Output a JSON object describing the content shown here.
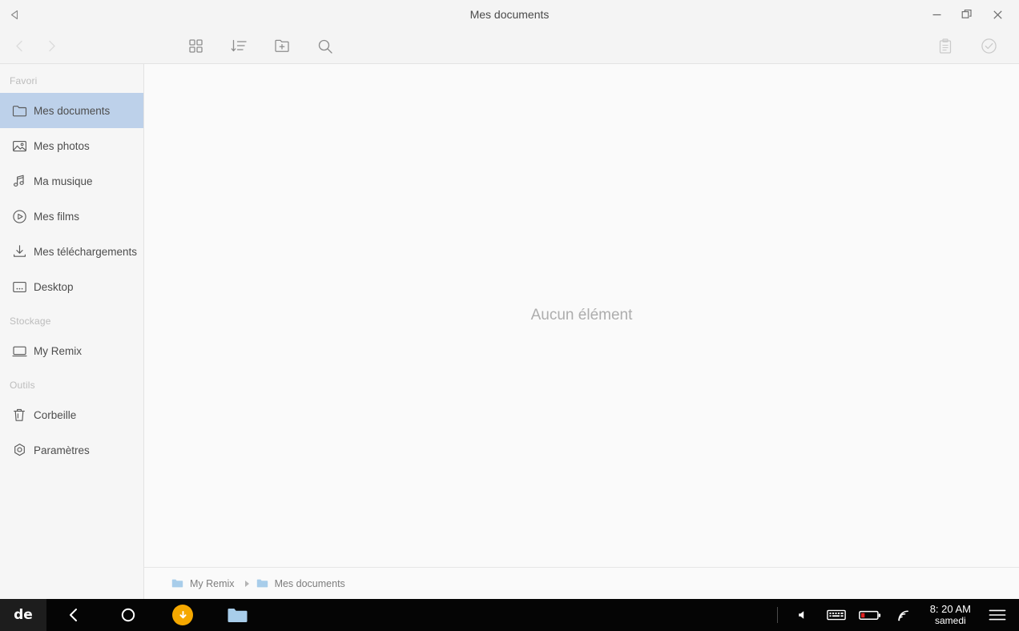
{
  "window": {
    "title": "Mes documents",
    "back_arrow_icon": "triangle-left-icon",
    "controls": [
      {
        "name": "minimize-button",
        "icon": "minimize-icon"
      },
      {
        "name": "restore-button",
        "icon": "restore-window-icon"
      },
      {
        "name": "close-button",
        "icon": "close-icon"
      }
    ]
  },
  "toolbar": {
    "nav": [
      {
        "name": "back-button",
        "icon": "chevron-left-icon",
        "enabled": false
      },
      {
        "name": "forward-button",
        "icon": "chevron-right-icon",
        "enabled": false
      }
    ],
    "tools": [
      {
        "name": "grid-view-button",
        "icon": "grid-view-icon"
      },
      {
        "name": "sort-button",
        "icon": "sort-descending-icon"
      },
      {
        "name": "new-folder-button",
        "icon": "new-folder-icon"
      },
      {
        "name": "search-button",
        "icon": "search-icon"
      }
    ],
    "right": [
      {
        "name": "paste-button",
        "icon": "clipboard-icon"
      },
      {
        "name": "select-mode-button",
        "icon": "check-circle-icon"
      }
    ]
  },
  "sidebar": {
    "sections": [
      {
        "title": "Favori",
        "items": [
          {
            "label": "Mes documents",
            "icon": "folder-icon",
            "selected": true
          },
          {
            "label": "Mes photos",
            "icon": "image-icon",
            "selected": false
          },
          {
            "label": "Ma musique",
            "icon": "music-note-icon",
            "selected": false
          },
          {
            "label": "Mes films",
            "icon": "play-circle-icon",
            "selected": false
          },
          {
            "label": "Mes téléchargements",
            "icon": "download-icon",
            "selected": false
          },
          {
            "label": "Desktop",
            "icon": "monitor-icon",
            "selected": false
          }
        ]
      },
      {
        "title": "Stockage",
        "items": [
          {
            "label": "My Remix",
            "icon": "device-icon",
            "selected": false
          }
        ]
      },
      {
        "title": "Outils",
        "items": [
          {
            "label": "Corbeille",
            "icon": "trash-icon",
            "selected": false
          },
          {
            "label": "Paramètres",
            "icon": "settings-gear-icon",
            "selected": false
          }
        ]
      }
    ]
  },
  "main": {
    "empty_message": "Aucun élément"
  },
  "breadcrumb": {
    "items": [
      {
        "label": "My Remix",
        "icon": "folder-icon"
      },
      {
        "label": "Mes documents",
        "icon": "folder-icon"
      }
    ]
  },
  "taskbar": {
    "logo": "de",
    "nav": [
      {
        "name": "taskbar-back-button",
        "icon": "chevron-left-icon"
      },
      {
        "name": "taskbar-home-button",
        "icon": "circle-icon"
      }
    ],
    "apps": [
      {
        "name": "taskbar-downloads-app",
        "icon": "download-badge-icon"
      },
      {
        "name": "taskbar-files-app",
        "icon": "folder-icon"
      }
    ],
    "system": [
      {
        "name": "volume-icon",
        "icon": "speaker-icon"
      },
      {
        "name": "keyboard-icon",
        "icon": "keyboard-icon"
      },
      {
        "name": "battery-icon",
        "icon": "battery-low-icon"
      },
      {
        "name": "wifi-icon",
        "icon": "wifi-icon"
      }
    ],
    "clock": {
      "time": "8: 20 AM",
      "day": "samedi"
    },
    "menu_icon": "hamburger-menu-icon"
  },
  "colors": {
    "selection": "#bdd1ea",
    "accent_orange": "#f5a800",
    "folder_blue": "#a8cdea",
    "battery_red": "#e02020"
  }
}
